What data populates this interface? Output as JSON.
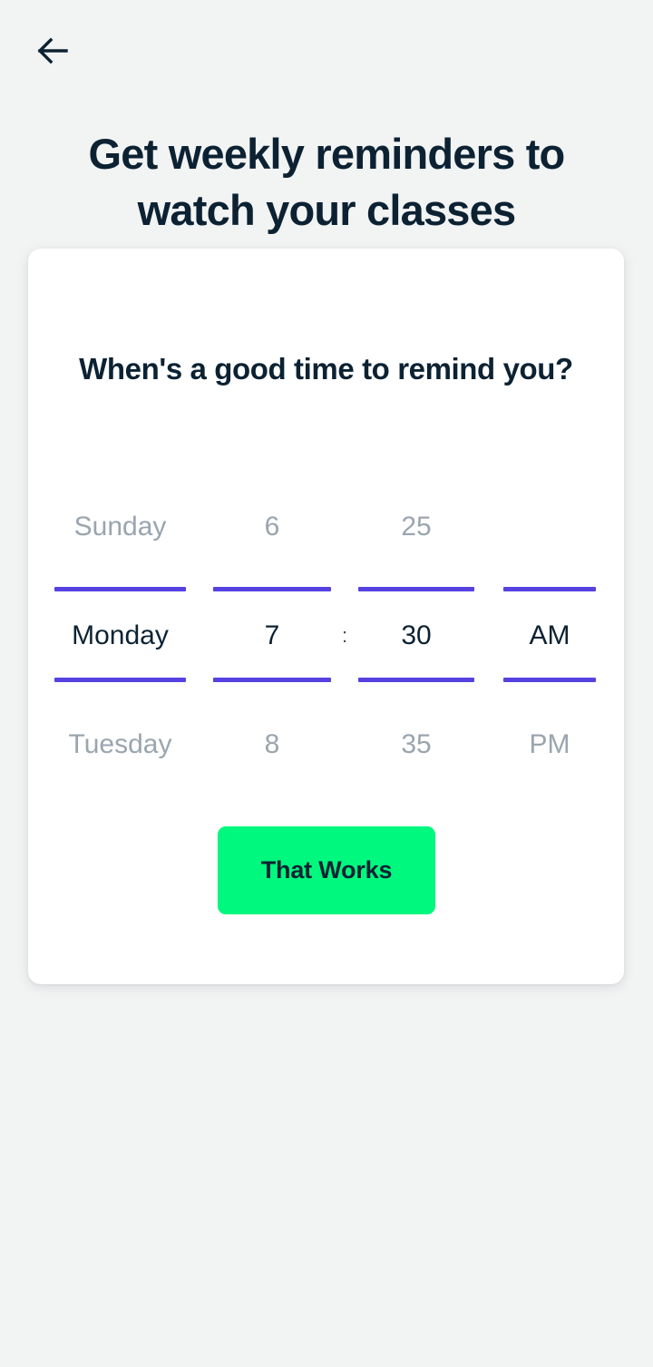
{
  "screen": {
    "background_color": "#F2F3F3",
    "title": "Get weekly reminders to watch your classes"
  },
  "nav": {
    "back_label": "Back",
    "back_icon": "arrow-left-icon",
    "icon_color": "#0C2233"
  },
  "card": {
    "background_color": "#FFFFFF",
    "heading": "When's a good time to remind you?",
    "picker": {
      "accent_color": "#5542E0",
      "inactive_text_color": "#9AA5AF",
      "active_text_color": "#0C2233",
      "separator": ":",
      "columns": [
        {
          "name": "day",
          "previous": "Sunday",
          "selected": "Monday",
          "next": "Tuesday"
        },
        {
          "name": "hour",
          "previous": "6",
          "selected": "7",
          "next": "8"
        },
        {
          "name": "minute",
          "previous": "25",
          "selected": "30",
          "next": "35"
        },
        {
          "name": "meridiem",
          "previous": "",
          "selected": "AM",
          "next": "PM"
        }
      ]
    },
    "confirm_button": {
      "label": "That Works",
      "background_color": "#00F87E",
      "text_color": "#0C2233"
    }
  }
}
